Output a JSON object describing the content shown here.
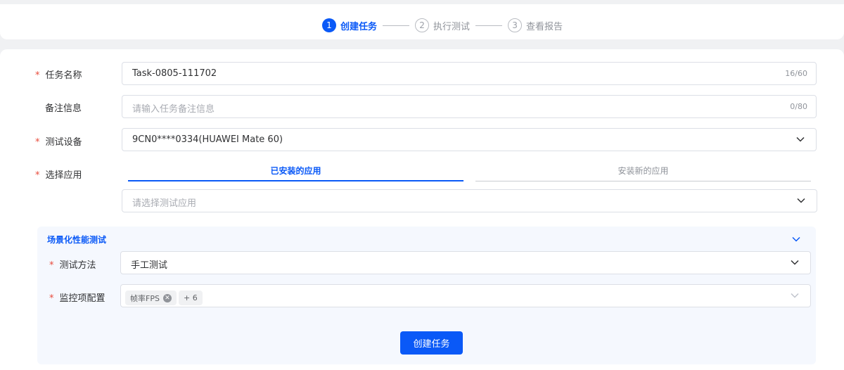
{
  "steps": [
    {
      "num": "1",
      "label": "创建任务",
      "state": "active"
    },
    {
      "num": "2",
      "label": "执行测试",
      "state": "inactive"
    },
    {
      "num": "3",
      "label": "查看报告",
      "state": "inactive"
    }
  ],
  "form": {
    "task_name": {
      "label": "任务名称",
      "required": "*",
      "value": "Task-0805-111702",
      "count": "16/60"
    },
    "remark": {
      "label": "备注信息",
      "placeholder": "请输入任务备注信息",
      "count": "0/80"
    },
    "device": {
      "label": "测试设备",
      "required": "*",
      "value": "9CN0****0334(HUAWEI Mate 60)"
    },
    "app": {
      "label": "选择应用",
      "required": "*",
      "tabs": [
        "已安装的应用",
        "安装新的应用"
      ],
      "placeholder": "请选择测试应用"
    }
  },
  "section": {
    "title": "场景化性能测试",
    "method": {
      "label": "测试方法",
      "required": "*",
      "value": "手工测试"
    },
    "monitor": {
      "label": "监控项配置",
      "required": "*",
      "tags": [
        "帧率FPS"
      ],
      "more": "+ 6"
    }
  },
  "submit_label": "创建任务",
  "colors": {
    "accent": "#0a59f7",
    "required": "#e84a3b"
  }
}
